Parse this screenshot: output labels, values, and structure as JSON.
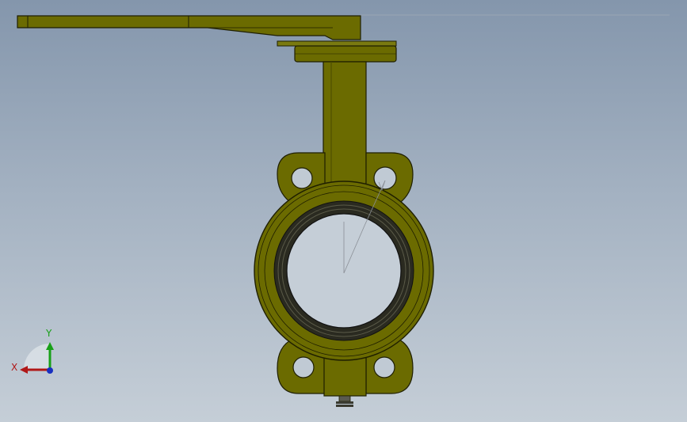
{
  "viewport": {
    "background_top": "#8496ac",
    "background_bottom": "#c5ced7"
  },
  "model": {
    "part_color": "#6b6b00",
    "part_edge_color": "#1e1e00",
    "seat_color": "#2a2a20"
  },
  "triad": {
    "x_label": "X",
    "y_label": "Y",
    "x_color": "#b01818",
    "y_color": "#18a018",
    "z_color": "#1830c0"
  }
}
